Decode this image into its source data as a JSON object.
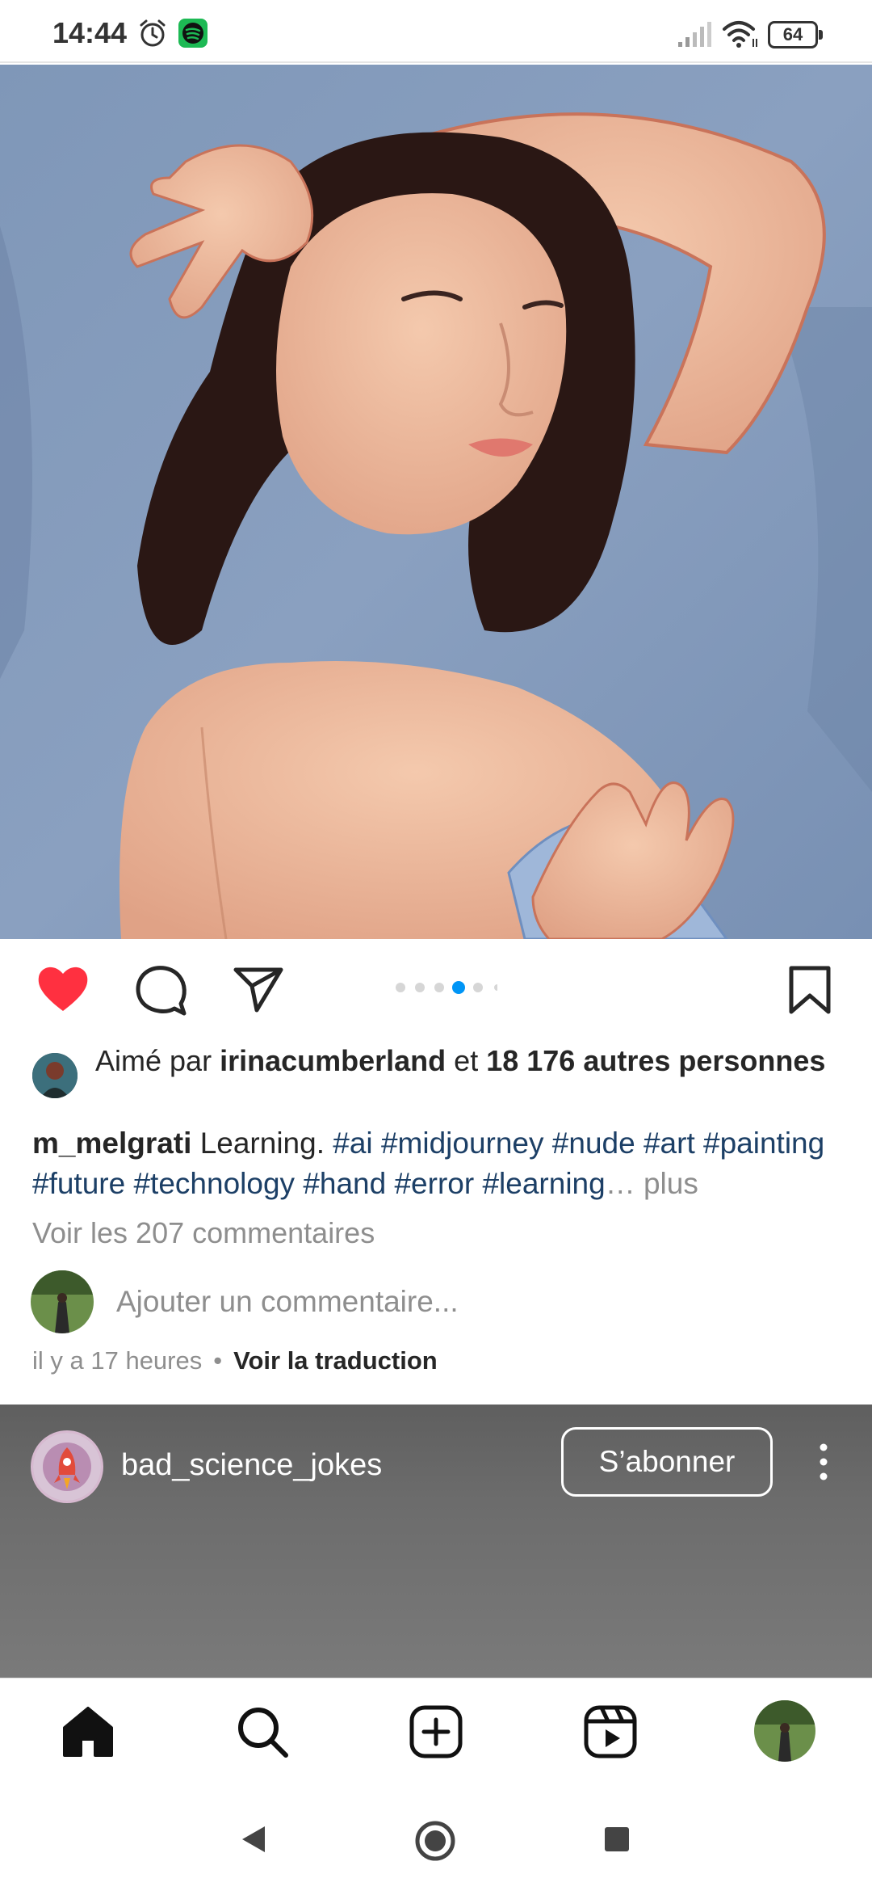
{
  "status_bar": {
    "time": "14:44",
    "battery": "64"
  },
  "post": {
    "likes_prefix": "Aimé par",
    "liker": "irinacumberland",
    "likes_connector": "et",
    "likes_count": "18 176 autres personnes",
    "author": "m_melgrati",
    "caption_text": "Learning.",
    "hashtags": [
      "#ai",
      "#midjourney",
      "#nude",
      "#art",
      "#painting",
      "#future",
      "#technology",
      "#hand",
      "#error",
      "#learning"
    ],
    "ellipsis": "…",
    "more_label": "plus",
    "view_comments": "Voir les 207 commentaires",
    "comment_placeholder": "Ajouter un commentaire...",
    "time_ago": "il y a 17 heures",
    "separator": "•",
    "translate_label": "Voir la traduction",
    "carousel": {
      "total": 6,
      "active_index": 3
    },
    "liked": true
  },
  "next_post": {
    "username": "bad_science_jokes",
    "follow_label": "S’abonner"
  },
  "colors": {
    "like_red": "#ff3040",
    "hashtag_blue": "#1c3f66",
    "dot_active": "#0095f6"
  },
  "bottom_nav": [
    "home-icon",
    "search-icon",
    "create-icon",
    "reels-icon",
    "profile-avatar"
  ],
  "system_nav": [
    "back-icon",
    "home-circle-icon",
    "recents-icon"
  ]
}
